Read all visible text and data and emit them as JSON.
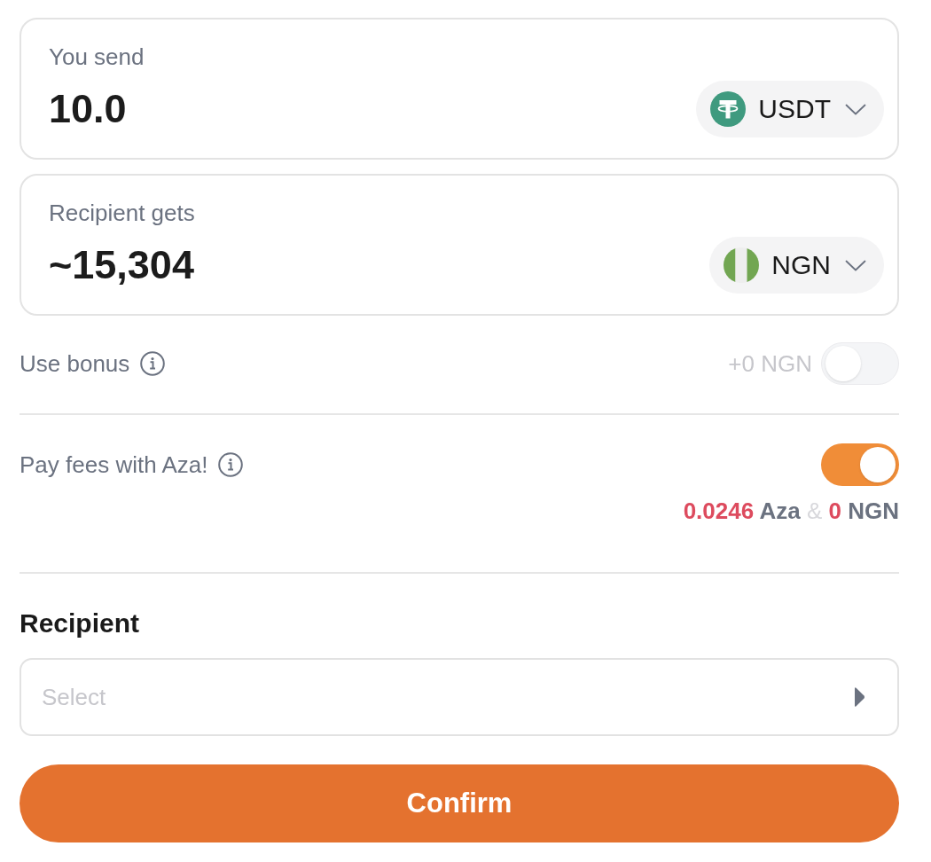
{
  "send": {
    "label": "You send",
    "value": "10.0",
    "currency": {
      "code": "USDT",
      "kind": "coin"
    }
  },
  "receive": {
    "label": "Recipient gets",
    "value": "~15,304",
    "currency": {
      "code": "NGN",
      "kind": "flag"
    }
  },
  "bonus": {
    "label": "Use bonus",
    "amount": "+0 NGN",
    "on": false,
    "disabled": true
  },
  "pay_fees": {
    "label": "Pay fees with Aza!",
    "on": true,
    "cost": [
      {
        "value": "0.0246",
        "unit": "Aza"
      },
      {
        "value": "0",
        "unit": "NGN"
      }
    ],
    "joiner": "&"
  },
  "recipient": {
    "heading": "Recipient",
    "placeholder": "Select"
  },
  "confirm": {
    "label": "Confirm"
  }
}
